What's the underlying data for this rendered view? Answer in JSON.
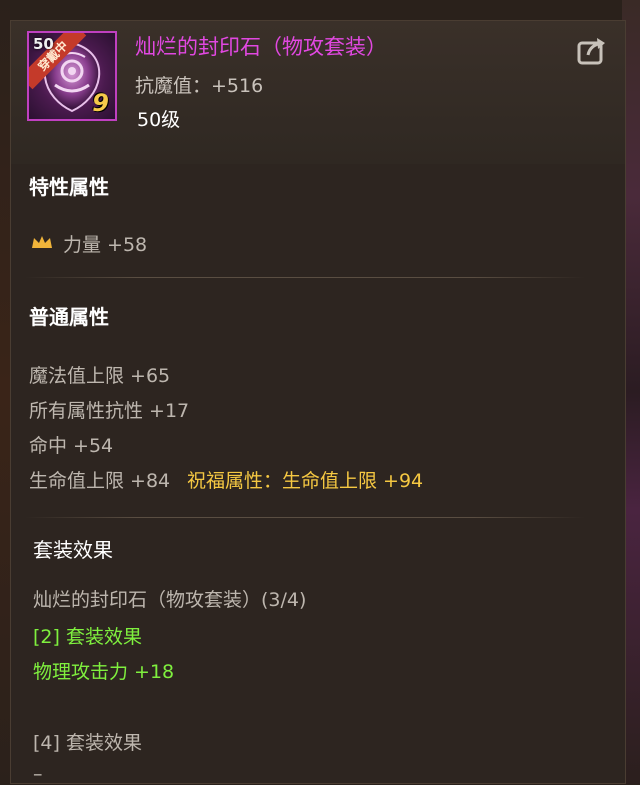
{
  "item": {
    "name": "灿烂的封印石（物攻套装）",
    "stat": "抗魔值：+516",
    "level": "50级",
    "icon_level_tag": "50",
    "icon_ribbon": "穿戴中",
    "enhance": "9"
  },
  "special": {
    "title": "特性属性",
    "attr": "力量 +58"
  },
  "normal": {
    "title": "普通属性",
    "lines": [
      "魔法值上限 +65",
      "所有属性抗性 +17",
      "命中 +54",
      "生命值上限 +84"
    ],
    "blessing": "祝福属性：生命值上限 +94"
  },
  "set": {
    "title": "套装效果",
    "name": "灿烂的封印石（物攻套装）(3/4)",
    "bonus2_title": "[2] 套装效果",
    "bonus2_value": "物理攻击力 +18",
    "bonus4_title": "[4] 套装效果",
    "bonus4_value": "–"
  },
  "colors": {
    "name": "#e148e1",
    "gold": "#f5c842",
    "green": "#7ff03e",
    "gray": "#bdb6ae",
    "icon_border": "#c040c0"
  },
  "icons": [
    "item-icon",
    "share-icon",
    "crown-icon"
  ]
}
